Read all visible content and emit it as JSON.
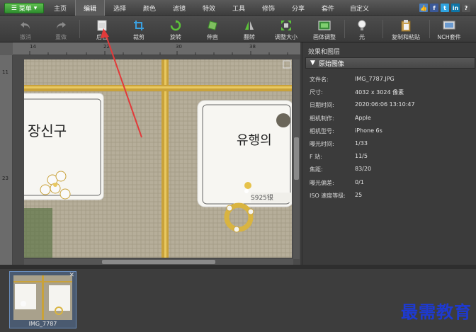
{
  "menubar": {
    "main_menu": "菜单",
    "tabs": [
      "主页",
      "编辑",
      "选择",
      "颜色",
      "滤镜",
      "特效",
      "工具",
      "修饰",
      "分享",
      "套件",
      "自定义"
    ],
    "active_tab": "编辑"
  },
  "toolbar": {
    "undo": "撤消",
    "redo": "重做",
    "crop_paste": "后台",
    "crop": "裁剪",
    "rotate": "旋转",
    "straighten": "伸直",
    "flip": "翻转",
    "resize": "调整大小",
    "canvas_adjust": "画体调整",
    "light": "光",
    "copy_paste": "复制和粘贴",
    "nch_suite": "NCH套件"
  },
  "rulers": {
    "top_ticks": [
      "14",
      "22",
      "30",
      "38"
    ],
    "left_ticks": [
      "11",
      "23"
    ]
  },
  "photo": {
    "card_left_text": "장신구",
    "card_right_text": "유행의",
    "stamp_text": "S925银"
  },
  "panel": {
    "title": "效果和图层",
    "section": "原始图像",
    "properties": [
      {
        "key": "文件名:",
        "value": "IMG_7787.JPG"
      },
      {
        "key": "尺寸:",
        "value": "4032 x 3024 像素"
      },
      {
        "key": "日期时间:",
        "value": "2020:06:06 13:10:47"
      },
      {
        "key": "相机制作:",
        "value": "Apple"
      },
      {
        "key": "相机型号:",
        "value": "iPhone 6s"
      },
      {
        "key": "曝光时间:",
        "value": "1/33"
      },
      {
        "key": "F 站:",
        "value": "11/5"
      },
      {
        "key": "焦距:",
        "value": "83/20"
      },
      {
        "key": "曝光偏差:",
        "value": "0/1"
      },
      {
        "key": "ISO 速度等级:",
        "value": "25"
      }
    ]
  },
  "filmstrip": {
    "items": [
      {
        "label": "IMG_7787"
      }
    ]
  },
  "watermark": "最需教育",
  "colors": {
    "accent_green": "#3aa63a",
    "annotation_arrow": "#e23a3a",
    "watermark_blue": "#1e3ad1"
  }
}
